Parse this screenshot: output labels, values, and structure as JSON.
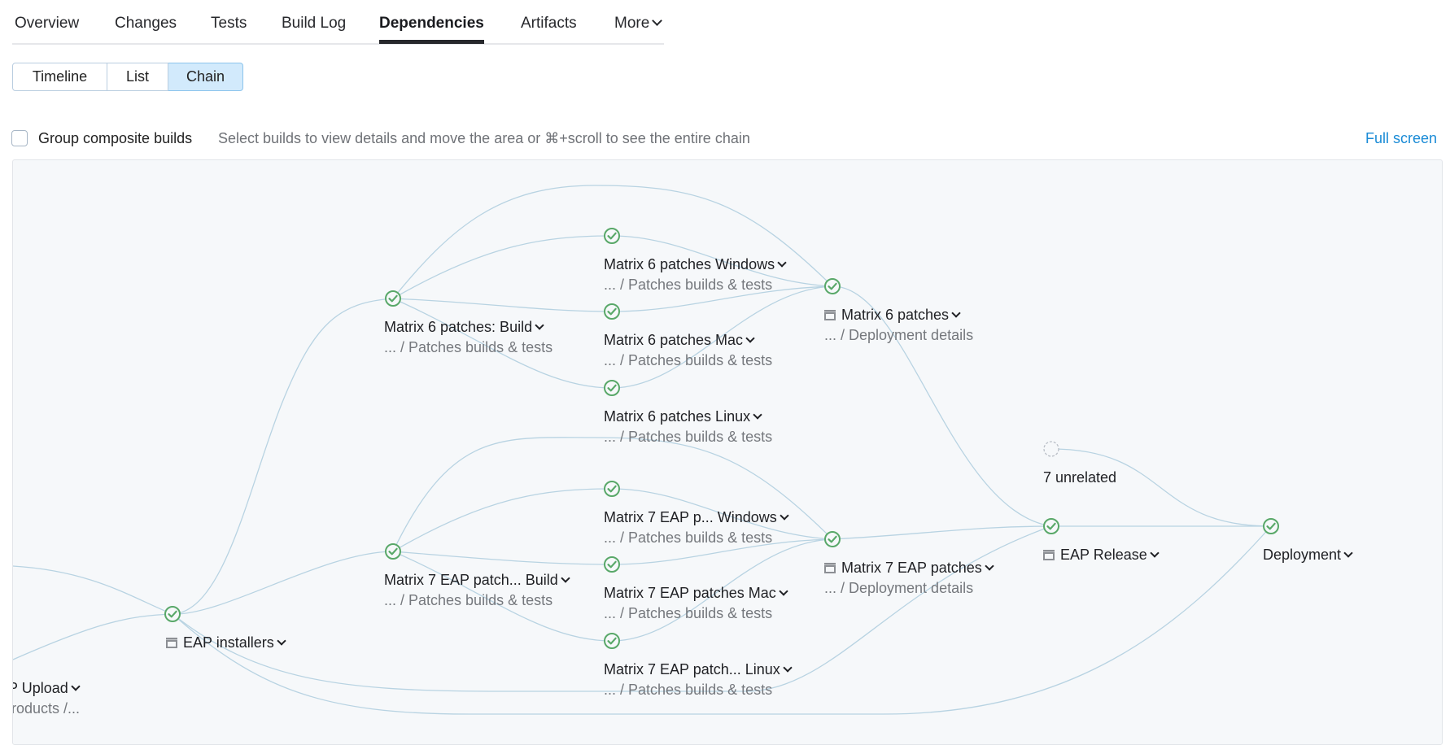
{
  "tabs": [
    {
      "label": "Overview",
      "active": false
    },
    {
      "label": "Changes",
      "active": false
    },
    {
      "label": "Tests",
      "active": false
    },
    {
      "label": "Build Log",
      "active": false
    },
    {
      "label": "Dependencies",
      "active": true
    },
    {
      "label": "Artifacts",
      "active": false
    },
    {
      "label": "More",
      "active": false,
      "dropdown": true
    }
  ],
  "view_switch": {
    "options": [
      "Timeline",
      "List",
      "Chain"
    ],
    "selected": "Chain"
  },
  "controls": {
    "group_composite_label": "Group composite builds",
    "group_composite_checked": false,
    "hint": "Select builds to view details and move the area or ⌘+scroll to see the entire chain",
    "full_screen_label": "Full screen"
  },
  "colors": {
    "success": "#59a869",
    "link": "#1a8bd6",
    "edge": "#b8d3e2",
    "selected_segment": "#d2eafc"
  },
  "graph": {
    "nodes": [
      {
        "id": "upload",
        "title": "ent EAP Upload",
        "subtitle": "tform Products /...",
        "status": "success",
        "composite": false
      },
      {
        "id": "eap_installers",
        "title": "EAP installers",
        "subtitle": "",
        "status": "success",
        "composite": true
      },
      {
        "id": "m6_build",
        "title": "Matrix 6 patches: Build",
        "subtitle": "... / Patches builds & tests",
        "status": "success",
        "composite": false
      },
      {
        "id": "m6_win",
        "title": "Matrix 6 patches Windows",
        "subtitle": "... / Patches builds & tests",
        "status": "success",
        "composite": false
      },
      {
        "id": "m6_mac",
        "title": "Matrix 6 patches Mac",
        "subtitle": "... / Patches builds & tests",
        "status": "success",
        "composite": false
      },
      {
        "id": "m6_linux",
        "title": "Matrix 6 patches Linux",
        "subtitle": "... / Patches builds & tests",
        "status": "success",
        "composite": false
      },
      {
        "id": "m6",
        "title": "Matrix 6 patches",
        "subtitle": "... / Deployment details",
        "status": "success",
        "composite": true
      },
      {
        "id": "m7_build",
        "title": "Matrix 7 EAP patch... Build",
        "subtitle": "... / Patches builds & tests",
        "status": "success",
        "composite": false
      },
      {
        "id": "m7_win",
        "title": "Matrix 7 EAP p...  Windows",
        "subtitle": "... / Patches builds & tests",
        "status": "success",
        "composite": false
      },
      {
        "id": "m7_mac",
        "title": "Matrix 7 EAP patches Mac",
        "subtitle": "... / Patches builds & tests",
        "status": "success",
        "composite": false
      },
      {
        "id": "m7_linux",
        "title": "Matrix 7 EAP patch... Linux",
        "subtitle": "... / Patches builds & tests",
        "status": "success",
        "composite": false
      },
      {
        "id": "m7",
        "title": "Matrix 7 EAP patches",
        "subtitle": "... / Deployment details",
        "status": "success",
        "composite": true
      },
      {
        "id": "unrelated",
        "title": "7 unrelated",
        "subtitle": "",
        "status": "unrelated",
        "composite": false
      },
      {
        "id": "eap_release",
        "title": "EAP Release",
        "subtitle": "",
        "status": "success",
        "composite": true
      },
      {
        "id": "deployment",
        "title": "Deployment",
        "subtitle": "",
        "status": "success",
        "composite": false
      }
    ]
  }
}
